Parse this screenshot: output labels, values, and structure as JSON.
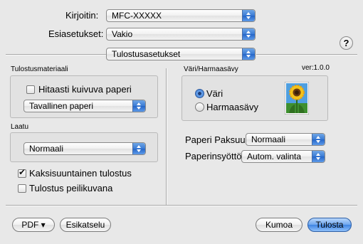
{
  "printer": {
    "label": "Kirjoitin:",
    "value": "MFC-XXXXX"
  },
  "presets": {
    "label": "Esiasetukset:",
    "value": "Vakio"
  },
  "panel": {
    "value": "Tulostusasetukset"
  },
  "help": {
    "glyph": "?"
  },
  "media": {
    "legend": "Tulostusmateriaali",
    "slow_dry_label": "Hitaasti kuivuva paperi",
    "slow_dry_checked": false,
    "type_value": "Tavallinen paperi"
  },
  "color": {
    "legend": "Väri/Harmaasävy",
    "version": "ver:1.0.0",
    "options": [
      {
        "label": "Väri",
        "selected": true
      },
      {
        "label": "Harmaasävy",
        "selected": false
      }
    ]
  },
  "quality": {
    "legend": "Laatu",
    "value": "Normaali"
  },
  "paper_thickness": {
    "label": "Paperi Paksuus:",
    "value": "Normaali"
  },
  "paper_feed": {
    "label": "Paperinsyöttö:",
    "value": "Autom. valinta"
  },
  "bidirectional": {
    "label": "Kaksisuuntainen tulostus",
    "checked": true
  },
  "mirror": {
    "label": "Tulostus peilikuvana",
    "checked": false
  },
  "buttons": {
    "pdf": "PDF ▾",
    "preview": "Esikatselu",
    "cancel": "Kumoa",
    "print": "Tulosta"
  }
}
